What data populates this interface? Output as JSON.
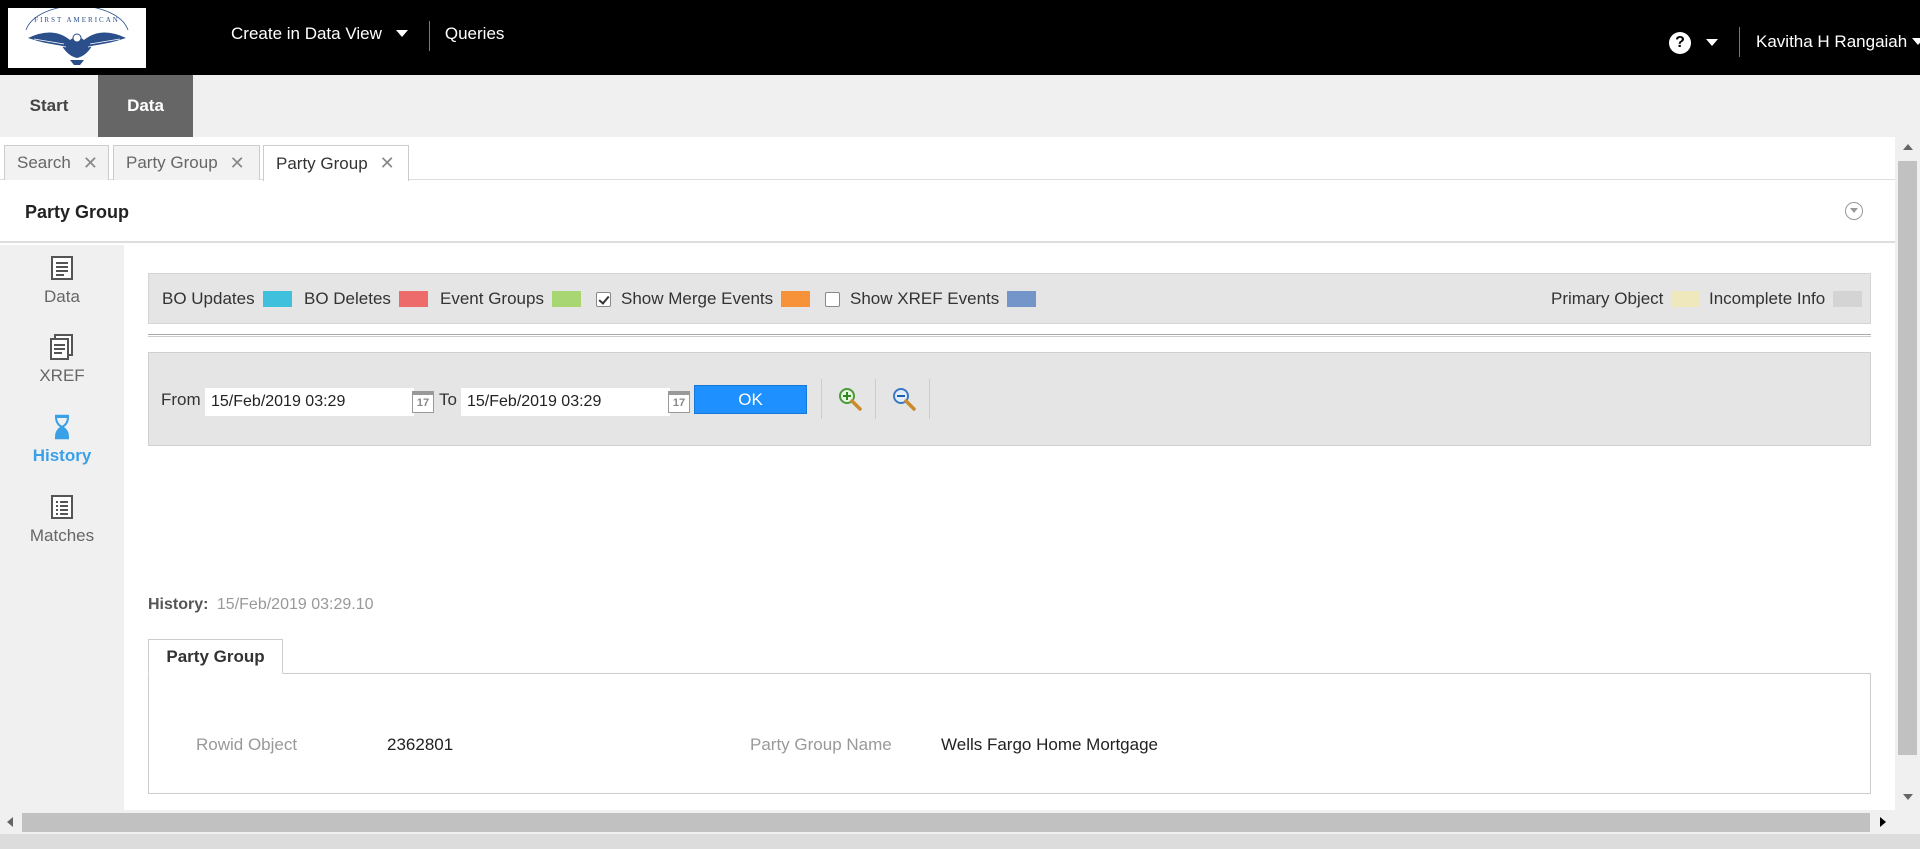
{
  "topbar": {
    "logo_text": "FIRST AMERICAN",
    "nav": {
      "create_label": "Create in Data View",
      "queries_label": "Queries"
    },
    "help_glyph": "?",
    "user_name": "Kavitha H Rangaiah"
  },
  "main_tabs": [
    {
      "label": "Start",
      "active": false
    },
    {
      "label": "Data",
      "active": true
    }
  ],
  "doc_tabs": [
    {
      "label": "Search",
      "close": "✕"
    },
    {
      "label": "Party Group",
      "close": "✕"
    },
    {
      "label": "Party Group",
      "close": "✕",
      "active": true
    }
  ],
  "page_title": "Party Group",
  "left_nav": [
    {
      "label": "Data",
      "icon": "document-icon"
    },
    {
      "label": "XREF",
      "icon": "stacked-document-icon"
    },
    {
      "label": "History",
      "icon": "hourglass-icon",
      "active": true
    },
    {
      "label": "Matches",
      "icon": "list-icon"
    }
  ],
  "legend": {
    "bo_updates": "BO Updates",
    "bo_deletes": "BO Deletes",
    "event_groups": "Event Groups",
    "show_merge_events": "Show Merge Events",
    "show_merge_checked": true,
    "show_xref_events": "Show XREF Events",
    "show_xref_checked": false,
    "primary_object": "Primary Object",
    "incomplete_info": "Incomplete Info",
    "colors": {
      "bo_updates": "#3fc1dd",
      "bo_deletes": "#ee6b6b",
      "event_groups": "#a8d672",
      "merge": "#f7923b",
      "xref": "#7395c9",
      "primary": "#f0e8bd",
      "incomplete": "#d4d4d4"
    }
  },
  "range": {
    "from_label": "From",
    "from_value": "15/Feb/2019 03:29",
    "to_label": "To",
    "to_value": "15/Feb/2019 03:29",
    "calendar_glyph": "17",
    "ok_label": "OK"
  },
  "history": {
    "label": "History:",
    "value": "15/Feb/2019 03:29.10"
  },
  "detail": {
    "tab_label": "Party Group",
    "fields": [
      {
        "label": "Rowid Object",
        "value": "2362801"
      },
      {
        "label": "Party Group Name",
        "value": "Wells Fargo Home Mortgage"
      }
    ]
  }
}
